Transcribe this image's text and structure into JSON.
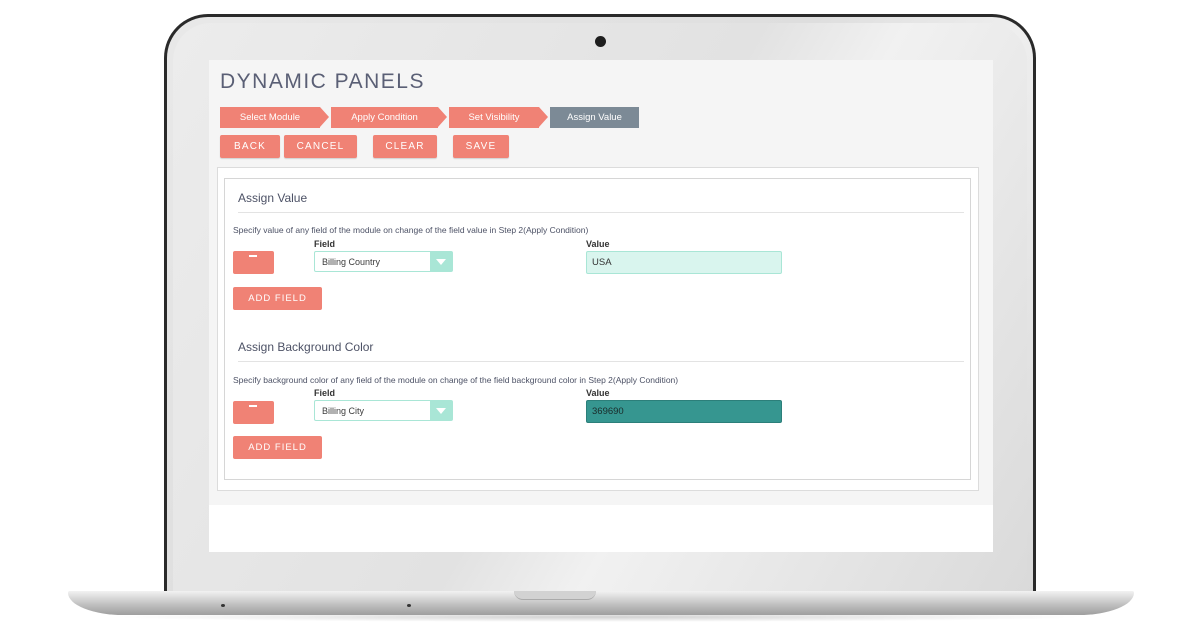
{
  "page": {
    "title": "DYNAMIC PANELS"
  },
  "steps": [
    {
      "label": "Select Module",
      "state": "done"
    },
    {
      "label": "Apply Condition",
      "state": "done"
    },
    {
      "label": "Set Visibility",
      "state": "done"
    },
    {
      "label": "Assign Value",
      "state": "active"
    }
  ],
  "toolbar": {
    "back_label": "BACK",
    "cancel_label": "CANCEL",
    "clear_label": "CLEAR",
    "save_label": "SAVE"
  },
  "assign_value": {
    "title": "Assign Value",
    "description": "Specify value of any field of the module on change of the field value in Step 2(Apply Condition)",
    "field_label": "Field",
    "value_label": "Value",
    "rows": [
      {
        "field": "Billing Country",
        "value": "USA"
      }
    ],
    "add_field_label": "ADD FIELD"
  },
  "assign_background": {
    "title": "Assign Background Color",
    "description": "Specify background color of any field of the module on change of the field background color in Step 2(Apply Condition)",
    "field_label": "Field",
    "value_label": "Value",
    "rows": [
      {
        "field": "Billing City",
        "value": "369690"
      }
    ],
    "add_field_label": "ADD FIELD"
  },
  "colors": {
    "accent": "#f08275",
    "active_step": "#7c8a96",
    "select_border": "#a9e6d6",
    "value_highlight": "#d9f5ee",
    "assigned_background": "#369690"
  }
}
